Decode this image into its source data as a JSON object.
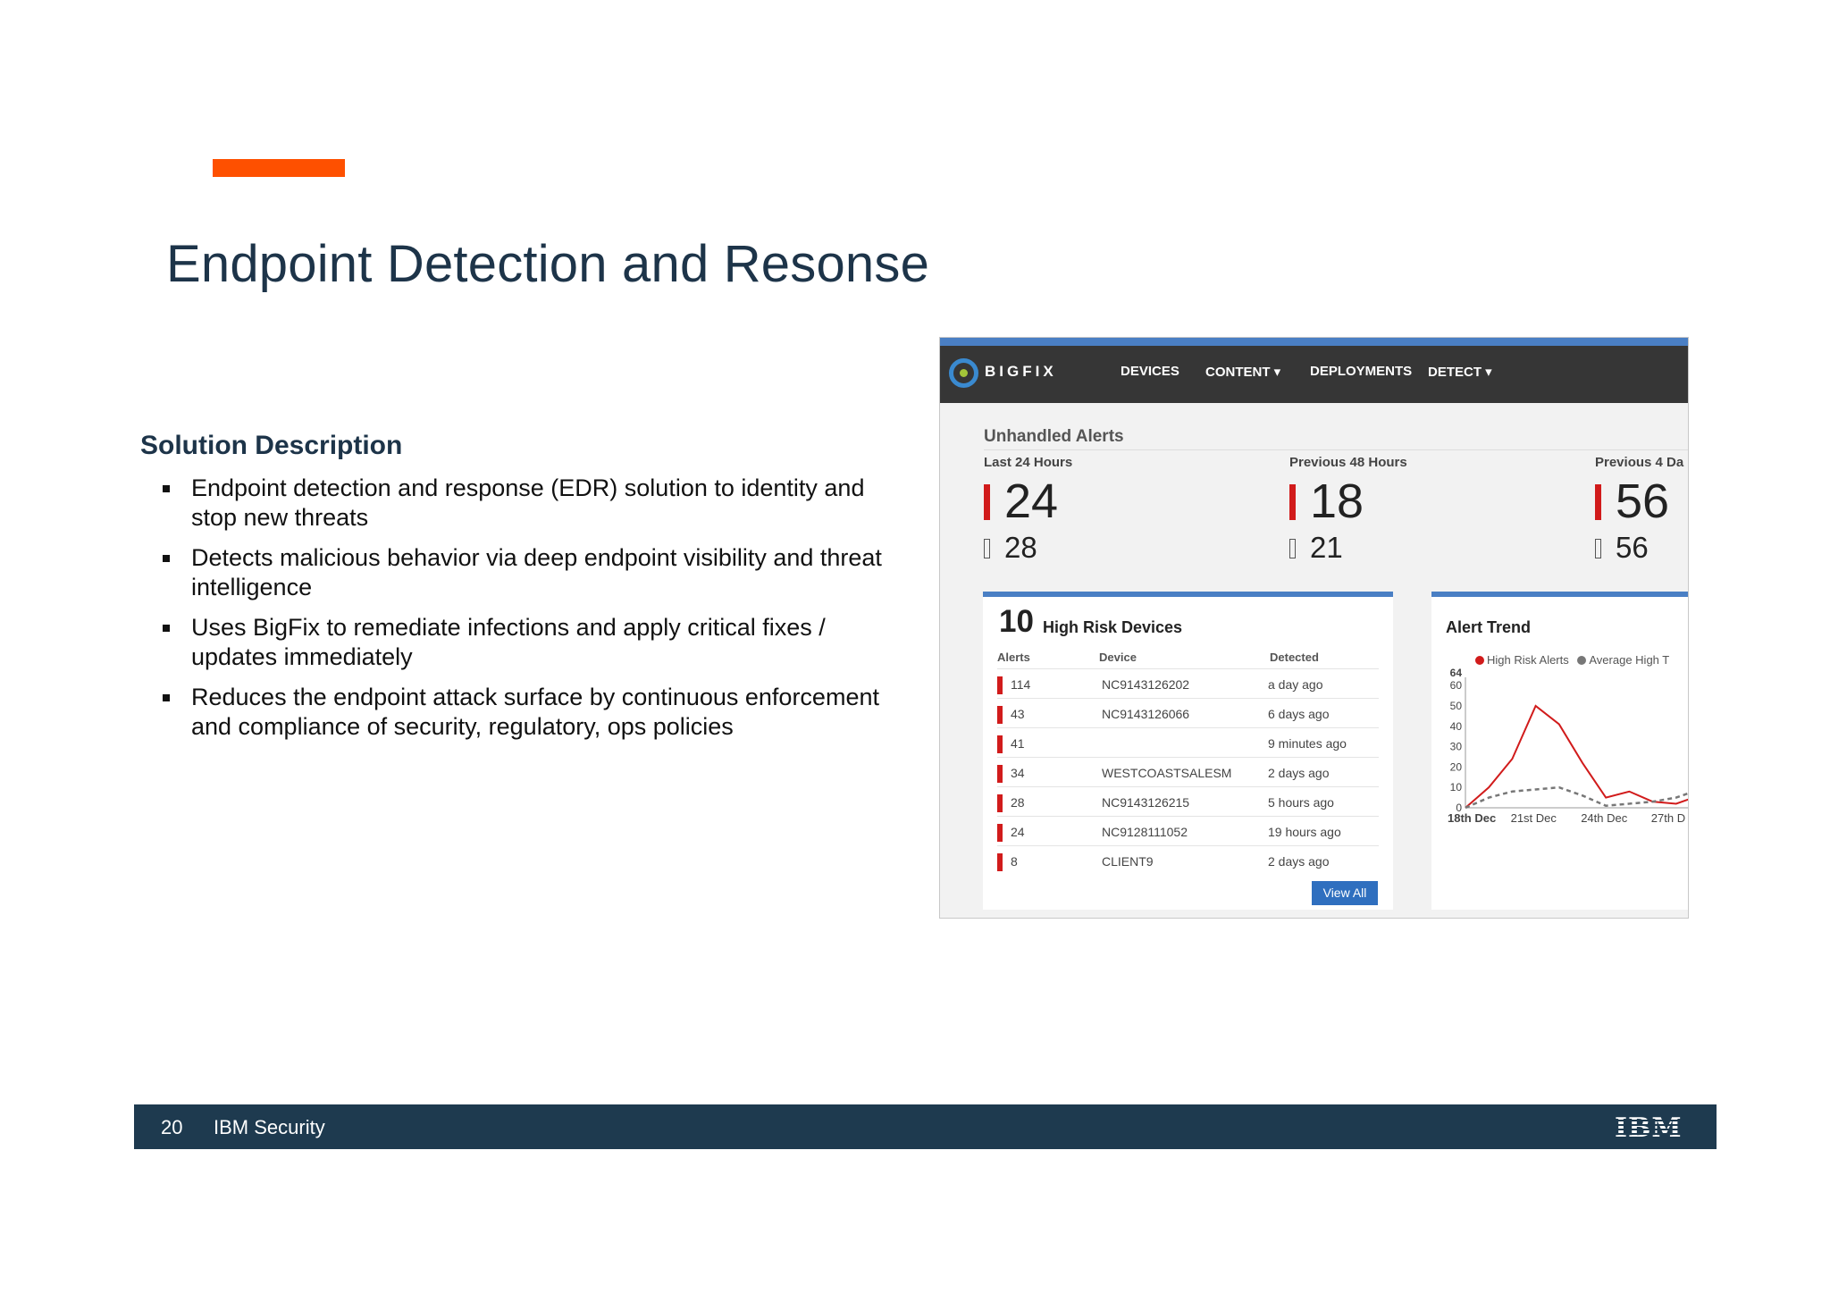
{
  "slide": {
    "title": "Endpoint Detection and Resonse",
    "section_heading": "Solution Description",
    "bullets": [
      "Endpoint detection and response (EDR) solution to identity and stop new threats",
      "Detects malicious behavior via deep endpoint visibility and threat intelligence",
      "Uses BigFix to remediate infections and apply critical fixes / updates immediately",
      "Reduces the endpoint attack surface by continuous enforcement and compliance of security, regulatory, ops policies"
    ],
    "accent_color": "#fe5000"
  },
  "bigfix": {
    "logo_text": "BIGFIX",
    "nav": [
      "DEVICES",
      "CONTENT ▾",
      "DEPLOYMENTS",
      "DETECT ▾"
    ],
    "unhandled": {
      "title": "Unhandled Alerts",
      "columns": [
        {
          "label": "Last 24 Hours",
          "high": "24",
          "other": "28"
        },
        {
          "label": "Previous 48 Hours",
          "high": "18",
          "other": "21"
        },
        {
          "label": "Previous 4 Da",
          "high": "56",
          "other": "56"
        }
      ]
    },
    "high_risk": {
      "count": "10",
      "title": "High Risk Devices",
      "headers": [
        "Alerts",
        "Device",
        "Detected"
      ],
      "rows": [
        {
          "alerts": "114",
          "device": "NC9143126202",
          "detected": "a day ago"
        },
        {
          "alerts": "43",
          "device": "NC9143126066",
          "detected": "6 days ago"
        },
        {
          "alerts": "41",
          "device": "",
          "detected": "9 minutes ago"
        },
        {
          "alerts": "34",
          "device": "WESTCOASTSALESM",
          "detected": "2 days ago"
        },
        {
          "alerts": "28",
          "device": "NC9143126215",
          "detected": "5 hours ago"
        },
        {
          "alerts": "24",
          "device": "NC9128111052",
          "detected": "19 hours ago"
        },
        {
          "alerts": "8",
          "device": "CLIENT9",
          "detected": "2 days ago"
        }
      ],
      "view_all": "View All"
    },
    "alert_trend": {
      "title": "Alert Trend",
      "legend_high": "High Risk Alerts",
      "legend_avg": "Average High T",
      "color_high": "#d11b1b",
      "color_avg": "#777777"
    }
  },
  "chart_data": {
    "type": "line",
    "title": "Alert Trend",
    "x": [
      "18th Dec",
      "",
      "",
      "21st Dec",
      "",
      "",
      "24th Dec",
      "",
      "",
      "27th D",
      ""
    ],
    "x_tick_labels": [
      "18th Dec",
      "21st Dec",
      "24th Dec",
      "27th D"
    ],
    "y_ticks": [
      "0",
      "10",
      "20",
      "30",
      "40",
      "50",
      "60",
      "64"
    ],
    "ylim": [
      0,
      64
    ],
    "series": [
      {
        "name": "High Risk Alerts",
        "values": [
          0,
          10,
          24,
          50,
          41,
          22,
          5,
          8,
          3,
          2,
          6
        ]
      },
      {
        "name": "Average High T",
        "values": [
          0,
          5,
          8,
          9,
          10,
          6,
          1,
          2,
          3,
          5,
          9
        ]
      }
    ]
  },
  "footer": {
    "page": "20",
    "brand": "IBM Security",
    "logo": "IBM"
  }
}
